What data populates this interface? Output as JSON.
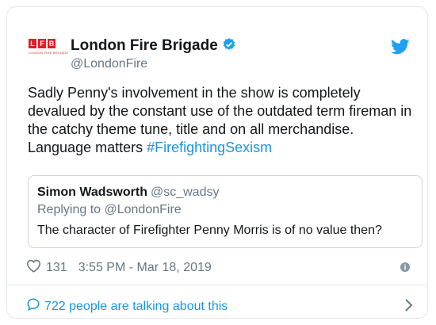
{
  "account": {
    "logo_letters": [
      "L",
      "F",
      "B"
    ],
    "logo_tagline": "LONDON FIRE BRIGADE",
    "name": "London Fire Brigade",
    "handle": "@LondonFire",
    "verified": true
  },
  "tweet": {
    "text": "Sadly Penny's involvement in the show is completely devalued by the constant use of the outdated term fireman in the catchy theme tune, title and on all merchandise. Language matters ",
    "hashtag": "#FirefightingSexism"
  },
  "quoted": {
    "name": "Simon Wadsworth",
    "handle": "@sc_wadsy",
    "replying_to": "Replying to @LondonFire",
    "text": "The character of Firefighter Penny Morris is of no value then?"
  },
  "meta": {
    "likes": "131",
    "timestamp": "3:55 PM - Mar 18, 2019"
  },
  "footer": {
    "talking": "722 people are talking about this"
  },
  "colors": {
    "link": "#1b95e0",
    "brand_red": "#e31b23",
    "muted": "#657786"
  },
  "icons": [
    "twitter-bird-icon",
    "verified-badge-icon",
    "heart-icon",
    "info-icon",
    "comment-bubble-icon",
    "chevron-right-icon"
  ]
}
